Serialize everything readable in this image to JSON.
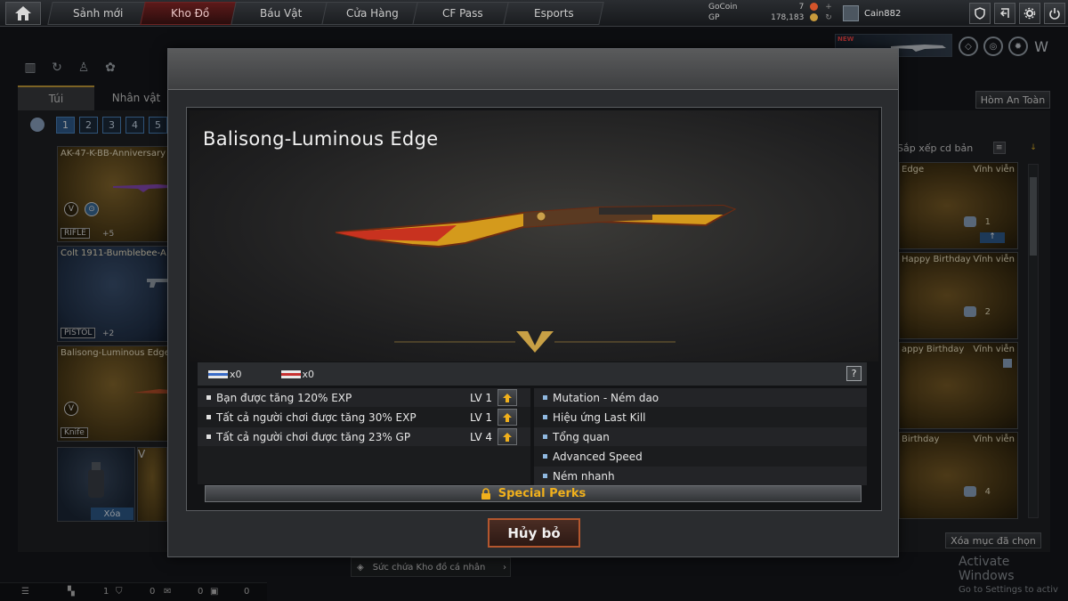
{
  "nav": {
    "tabs": [
      {
        "label": "Sảnh mới"
      },
      {
        "label": "Kho Đồ"
      },
      {
        "label": "Báu Vật"
      },
      {
        "label": "Cửa Hàng"
      },
      {
        "label": "CF Pass"
      },
      {
        "label": "Esports"
      }
    ],
    "active_tab": "Kho Đồ"
  },
  "currency": {
    "gocoin_label": "GoCoin",
    "gocoin_value": "7",
    "gp_label": "GP",
    "gp_value": "178,183"
  },
  "user": {
    "name": "Cain882"
  },
  "banner": {
    "tag": "NEW"
  },
  "inventory": {
    "tabs": [
      {
        "label": "Túi"
      },
      {
        "label": "Nhân vật"
      }
    ],
    "pages": [
      "1",
      "2",
      "3",
      "4",
      "5"
    ],
    "active_page": "1",
    "cards": [
      {
        "title": "AK-47-K-BB-Anniversary",
        "type": "RIFLE",
        "extra": "+5"
      },
      {
        "title": "Colt 1911-Bumblebee-A",
        "type": "PISTOL",
        "extra": "+2"
      },
      {
        "title": "Balisong-Luminous Edge",
        "type": "Knife",
        "extra": ""
      }
    ],
    "delete_label": "Xóa",
    "safe_button": "Hòm An Toàn",
    "sort_label": "Sắp xếp cd bản",
    "right_cards": [
      {
        "name": "Edge",
        "duration": "Vĩnh viễn",
        "count": "1"
      },
      {
        "name": "Happy Birthday",
        "duration": "Vĩnh viễn",
        "count": "2"
      },
      {
        "name": "appy Birthday",
        "duration": "Vĩnh viễn",
        "count": ""
      },
      {
        "name": "Birthday",
        "duration": "Vĩnh viễn",
        "count": "4"
      }
    ],
    "clear_selected": "Xóa mục đã chọn",
    "storage_label": "Sức chứa Kho đồ cá nhân"
  },
  "statusbar": {
    "values": [
      "1",
      "0",
      "0",
      "0"
    ]
  },
  "watermark": {
    "line1": "Activate Windows",
    "line2": "Go to Settings to activ"
  },
  "modal": {
    "item_title": "Balisong-Luminous Edge",
    "slots": [
      {
        "count": "x0"
      },
      {
        "count": "x0"
      }
    ],
    "help_label": "?",
    "perks": [
      {
        "text": "Bạn được tăng 120%  EXP",
        "level": "LV 1"
      },
      {
        "text": "Tất cả người chơi được tăng 30% EXP",
        "level": "LV 1"
      },
      {
        "text": "Tất cả người chơi được tăng 23% GP",
        "level": "LV 4"
      }
    ],
    "effects": [
      {
        "text": "Mutation - Ném dao"
      },
      {
        "text": "Hiệu ứng Last Kill"
      },
      {
        "text": "Tổng quan"
      },
      {
        "text": "Advanced Speed"
      },
      {
        "text": "Ném nhanh"
      }
    ],
    "special_perks_label": "Special Perks",
    "cancel_label": "Hủy bỏ"
  },
  "colors": {
    "accent_gold": "#f0b01c",
    "cancel_border": "#b3562e",
    "active_tab": "#5c1a1a",
    "page_blue": "#2f5c8e"
  }
}
